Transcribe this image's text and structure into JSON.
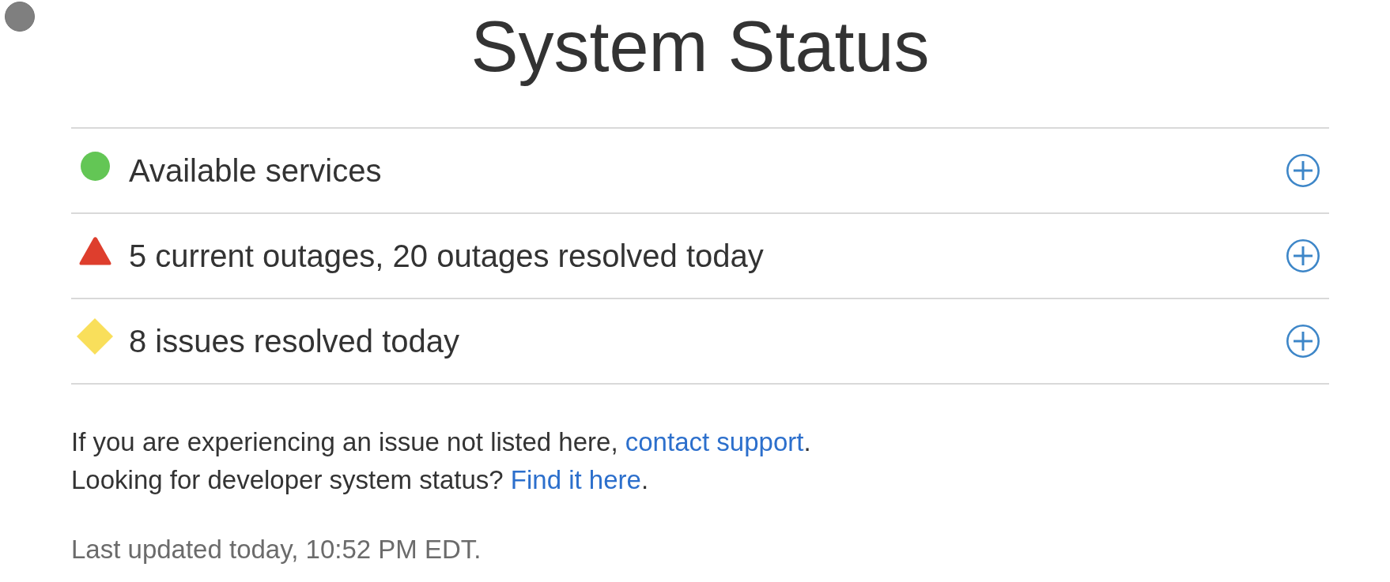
{
  "title": "System Status",
  "statuses": [
    {
      "kind": "available",
      "text": "Available services",
      "color": "#63c655",
      "expanded": false
    },
    {
      "kind": "outage",
      "text": "5 current outages, 20 outages resolved today",
      "color": "#de3e2d",
      "expanded": false
    },
    {
      "kind": "issue",
      "text": "8 issues resolved today",
      "color": "#f9df5b",
      "expanded": false
    }
  ],
  "notes": [
    {
      "before": "If you are experiencing an issue not listed here,",
      "link": "contact support",
      "after": "."
    },
    {
      "before": "Looking for developer system status?",
      "link": "Find it here",
      "after": "."
    }
  ],
  "last_updated": "Last updated today, 10:52 PM EDT."
}
